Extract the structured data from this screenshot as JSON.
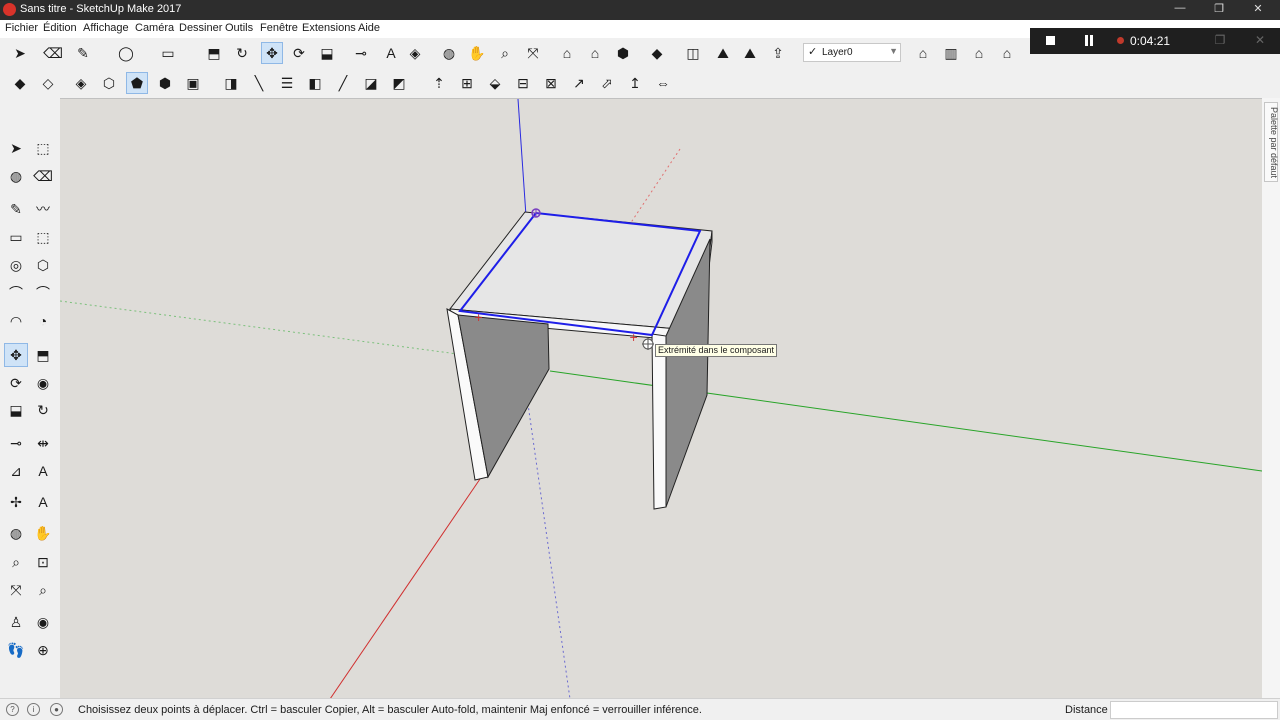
{
  "window": {
    "title": "Sans titre - SketchUp Make 2017",
    "minimize": "—",
    "maximize": "❐",
    "close": "✕"
  },
  "menu": [
    "Fichier",
    "Édition",
    "Affichage",
    "Caméra",
    "Dessiner",
    "Outils",
    "Fenêtre",
    "Extensions",
    "Aide"
  ],
  "recorder": {
    "time": "0:04:21"
  },
  "toolbar": {
    "layer_check": "✓",
    "layer_name": "Layer0",
    "icons1": [
      "select-icon",
      "eraser-icon",
      "pencil-icon",
      "shape-icon",
      "rectangle-icon",
      "push-pull-icon",
      "follow-me-icon",
      "move-icon",
      "rotate-icon",
      "scale-icon",
      "tape-measure-icon",
      "text-icon",
      "paint-bucket-icon",
      "orbit-icon",
      "pan-icon",
      "zoom-icon",
      "zoom-extents-icon",
      "warehouse-icon",
      "warehouse-share-icon",
      "extension-warehouse-icon",
      "ruby-icon",
      "dynamic-components-icon",
      "sandbox-icon",
      "sandbox-flip-icon",
      "export-icon"
    ],
    "icons2": [
      "xray-style-icon",
      "wireframe-style-icon",
      "hidden-line-style-icon",
      "shaded-style-icon",
      "shaded-textures-style-icon",
      "monochrome-style-icon",
      "box-view-icon",
      "section-icon",
      "section-cut-icon",
      "display-section-icon",
      "solid-tools-icon",
      "union-icon",
      "subtract-icon",
      "intersect-icon",
      "trim-icon",
      "split-icon",
      "sandbox-from-contours-icon",
      "from-scratch-icon",
      "smoove-icon",
      "stamp-icon",
      "drape-icon",
      "add-detail-icon",
      "flip-edge-icon"
    ],
    "view_icons": [
      "iso-view-icon",
      "top-view-icon",
      "front-view-icon",
      "right-view-icon",
      "back-view-icon",
      "left-view-icon"
    ]
  },
  "left_tools": [
    "select-tool",
    "component-tool",
    "paint-tool",
    "eraser-tool",
    "line-tool",
    "freehand-tool",
    "rectangle-tool",
    "rotated-rectangle-tool",
    "circle-tool",
    "polygon-tool",
    "arc-tool",
    "two-point-arc-tool",
    "three-point-arc-tool",
    "pie-tool",
    "move-tool",
    "push-pull-tool",
    "rotate-tool",
    "follow-me-tool",
    "scale-tool",
    "offset-tool",
    "tape-tool",
    "dimension-tool",
    "protractor-tool",
    "text-tool",
    "axes-tool",
    "3d-text-tool",
    "orbit-tool",
    "pan-tool",
    "zoom-tool",
    "zoom-window-tool",
    "zoom-extents-tool",
    "previous-view-tool",
    "position-camera-tool",
    "look-around-tool",
    "walk-tool",
    "section-plane-tool"
  ],
  "viewport": {
    "tooltip": "Extrémité dans le composant"
  },
  "tray": {
    "label": "Palette par défaut"
  },
  "status": {
    "hint": "Choisissez deux points à déplacer.  Ctrl = basculer Copier, Alt = basculer Auto-fold, maintenir Maj enfoncé = verrouiller inférence.",
    "measure_label": "Distance",
    "measure_value": ""
  },
  "colors": {
    "red_axis": "#d03030",
    "green_axis": "#28a428",
    "blue_axis": "#2a2ae0",
    "selection": "#1e1ee8",
    "shade_dark": "#8a8a8a",
    "face_top": "#e6e6e6",
    "background": "#dedcd8"
  }
}
